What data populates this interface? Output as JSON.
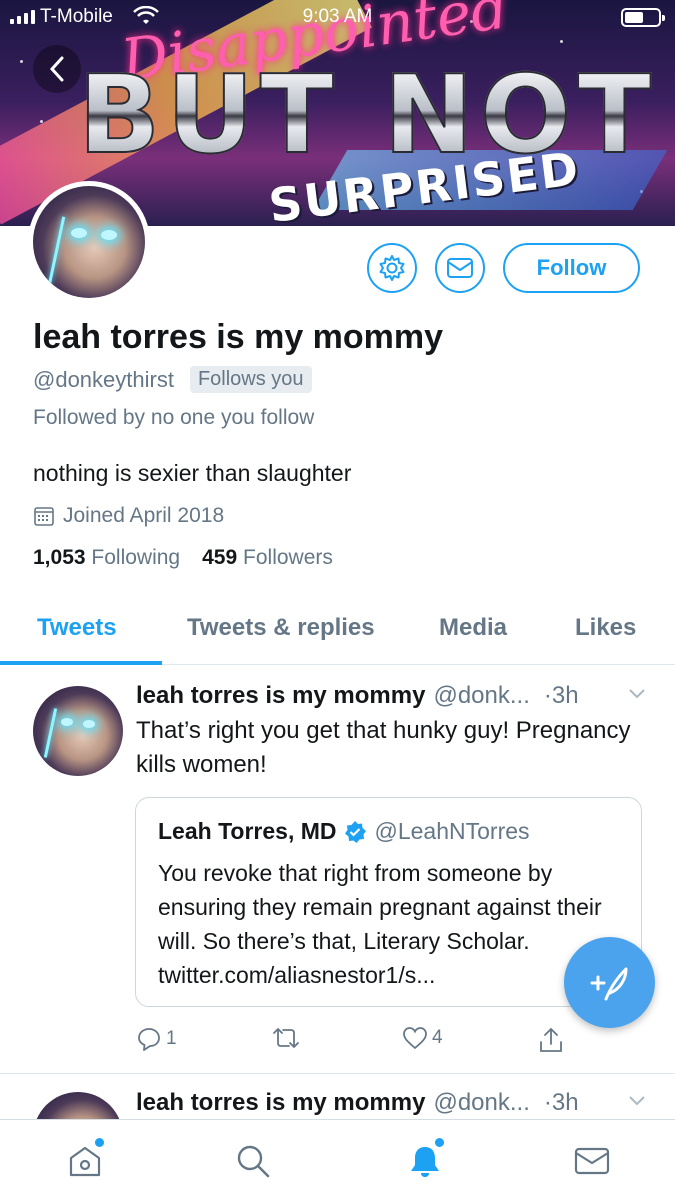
{
  "status_bar": {
    "carrier": "T-Mobile",
    "time": "9:03 AM"
  },
  "banner": {
    "line1": "Disappointed",
    "line2": "BUT NOT",
    "line3": "SURPRISED"
  },
  "profile": {
    "display_name": "leah torres is my mommy",
    "handle": "@donkeythirst",
    "follows_you": "Follows you",
    "followed_by": "Followed by no one you follow",
    "bio": "nothing is sexier than slaughter",
    "joined": "Joined April 2018",
    "following_count": "1,053",
    "following_label": "Following",
    "followers_count": "459",
    "followers_label": "Followers",
    "follow_button": "Follow"
  },
  "tabs": [
    {
      "label": "Tweets",
      "active": true
    },
    {
      "label": "Tweets & replies",
      "active": false
    },
    {
      "label": "Media",
      "active": false
    },
    {
      "label": "Likes",
      "active": false
    }
  ],
  "tweets": [
    {
      "name": "leah torres is my mommy",
      "handle": "@donk...",
      "time": "·3h",
      "text": "That’s right you get that hunky guy! Pregnancy kills women!",
      "quote": {
        "name": "Leah Torres, MD",
        "handle": "@LeahNTorres",
        "text": "You revoke that right from someone by ensuring they remain pregnant against their will. So there’s that, Literary Scholar. twitter.com/aliasnestor1/s..."
      },
      "reply_count": "1",
      "retweet_count": "",
      "like_count": "4"
    },
    {
      "name": "leah torres is my mommy",
      "handle": "@donk...",
      "time": "·3h"
    }
  ],
  "colors": {
    "accent": "#1da1f2",
    "muted": "#657786",
    "text": "#14171a"
  },
  "icons": {
    "back": "chevron-left-icon",
    "settings": "gear-icon",
    "message": "envelope-icon",
    "calendar": "calendar-icon",
    "verified": "verified-badge-icon",
    "compose": "compose-feather-icon",
    "nav": [
      "home-icon",
      "search-icon",
      "bell-icon",
      "mail-icon"
    ]
  }
}
